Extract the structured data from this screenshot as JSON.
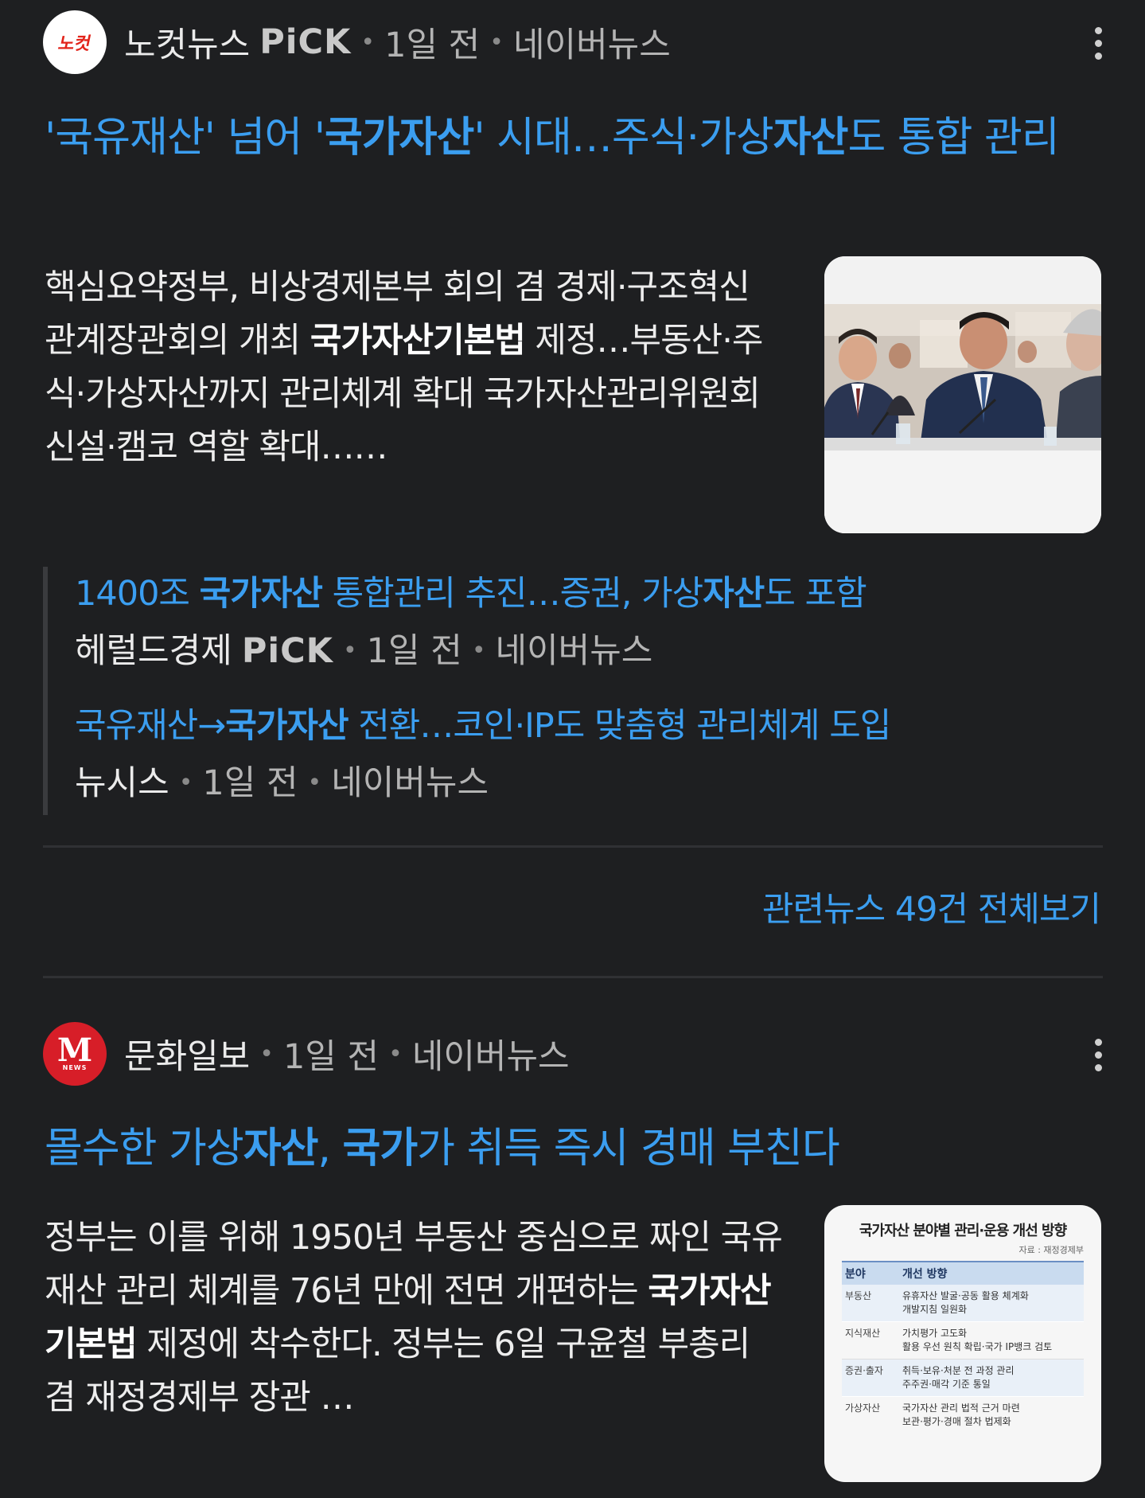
{
  "article1": {
    "source": "노컷뉴스",
    "pick": "PiCK",
    "time": "1일 전",
    "platform": "네이버뉴스",
    "logo_text": "노컷",
    "title_parts": [
      "'국유재산' 넘어 '",
      "국가자산",
      "' 시대…주식·가상",
      "자산",
      "도 통합 관리"
    ],
    "summary_parts": [
      "핵심요약정부, 비상경제본부 회의 겸 경제·구조혁신 관계장관회의 개최 ",
      "국가자산기본법",
      " 제정…부동산·주식·가상자산까지 관리체계 확대 국가자산관리위원회 신설·캠코 역할 확대……"
    ],
    "related": [
      {
        "title_parts": [
          "1400조 ",
          "국가자산",
          " 통합관리 추진…증권, 가상",
          "자산",
          "도 포함"
        ],
        "source": "헤럴드경제",
        "pick": "PiCK",
        "time": "1일 전",
        "platform": "네이버뉴스"
      },
      {
        "title_parts": [
          "국유재산→",
          "국가자산",
          " 전환…코인·IP도 맞춤형 관리체계 도입"
        ],
        "source": "뉴시스",
        "time": "1일 전",
        "platform": "네이버뉴스"
      }
    ],
    "more_link": "관련뉴스 49건 전체보기"
  },
  "article2": {
    "source": "문화일보",
    "time": "1일 전",
    "platform": "네이버뉴스",
    "logo_text": "M",
    "logo_sub": "NEWS",
    "title_parts": [
      "몰수한 가상",
      "자산",
      ", ",
      "국가",
      "가 취득 즉시 경매 부친다"
    ],
    "summary_parts": [
      "정부는 이를 위해 1950년 부동산 중심으로 짜인 국유재산 관리 체계를 76년 만에 전면 개편하는 ",
      "국가자산기본법",
      " 제정에 착수한다. 정부는 6일 구윤철 부총리 겸 재정경제부 장관 …"
    ],
    "thumb_table": {
      "title": "국가자산 분야별 관리·운용 개선 방향",
      "source": "자료 : 재정경제부",
      "headers": [
        "분야",
        "개선 방향"
      ],
      "rows": [
        [
          "부동산",
          "유휴자산 발굴·공동 활용 체계화",
          "개발지침 일원화"
        ],
        [
          "지식재산",
          "가치평가 고도화",
          "활용 우선 원칙 확립·국가 IP뱅크 검토"
        ],
        [
          "증권·출자",
          "취득·보유·처분 전 과정 관리",
          "주주권·매각 기준 통일"
        ],
        [
          "가상자산",
          "국가자산 관리 법적 근거 마련",
          "보관·평가·경매 절차 법제화"
        ]
      ]
    }
  },
  "colors": {
    "background": "#1e1f21",
    "link": "#3b9ef0",
    "text": "#ededed",
    "divider": "#303134"
  }
}
